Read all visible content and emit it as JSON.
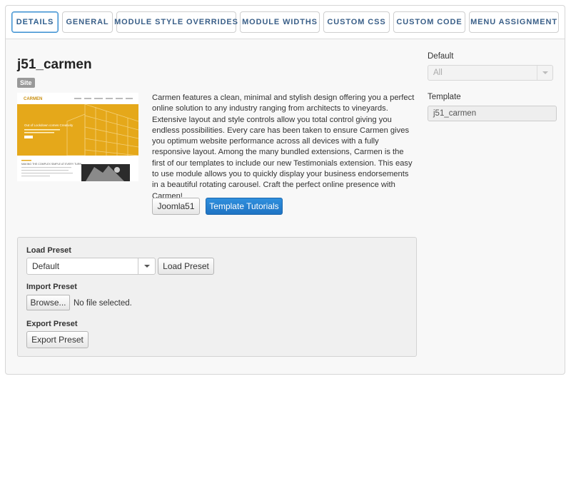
{
  "tabs": [
    {
      "label": "DETAILS",
      "active": true
    },
    {
      "label": "GENERAL",
      "active": false
    },
    {
      "label": "MODULE STYLE OVERRIDES",
      "active": false
    },
    {
      "label": "MODULE WIDTHS",
      "active": false
    },
    {
      "label": "CUSTOM CSS",
      "active": false
    },
    {
      "label": "CUSTOM CODE",
      "active": false
    },
    {
      "label": "MENU ASSIGNMENT",
      "active": false
    }
  ],
  "details": {
    "title": "j51_carmen",
    "badge": "Site",
    "description": "Carmen features a clean, minimal and stylish design offering you a perfect online solution to any industry ranging from architects to vineyards. Extensive layout and style controls allow you total control giving you endless possibilities. Every care has been taken to ensure Carmen gives you optimum website performance across all devices with a fully responsive layout. Among the many bundled extensions, Carmen is the first of our templates to include our new Testimonials extension. This easy to use module allows you to quickly display your business endorsements in a beautiful rotating carousel. Craft the perfect online presence with Carmen!",
    "buttons": {
      "joomla51": "Joomla51",
      "tutorials": "Template Tutorials"
    },
    "thumbnail": {
      "logo": "CARMEN",
      "hero_text": "Out of Lockdown comes Creativity",
      "content_heading": "MAKING THE COMPLEX SIMPLE AT EVERY TURN"
    }
  },
  "preset": {
    "load_label": "Load Preset",
    "load_select_value": "Default",
    "load_button": "Load Preset",
    "import_label": "Import Preset",
    "browse_button": "Browse...",
    "no_file": "No file selected.",
    "export_label": "Export Preset",
    "export_button": "Export Preset"
  },
  "sidebar": {
    "default_label": "Default",
    "default_value": "All",
    "template_label": "Template",
    "template_value": "j51_carmen"
  },
  "colors": {
    "accent": "#2f8fdd",
    "thumbnail_yellow": "#e5a81a",
    "tab_text": "#3a5f88"
  }
}
